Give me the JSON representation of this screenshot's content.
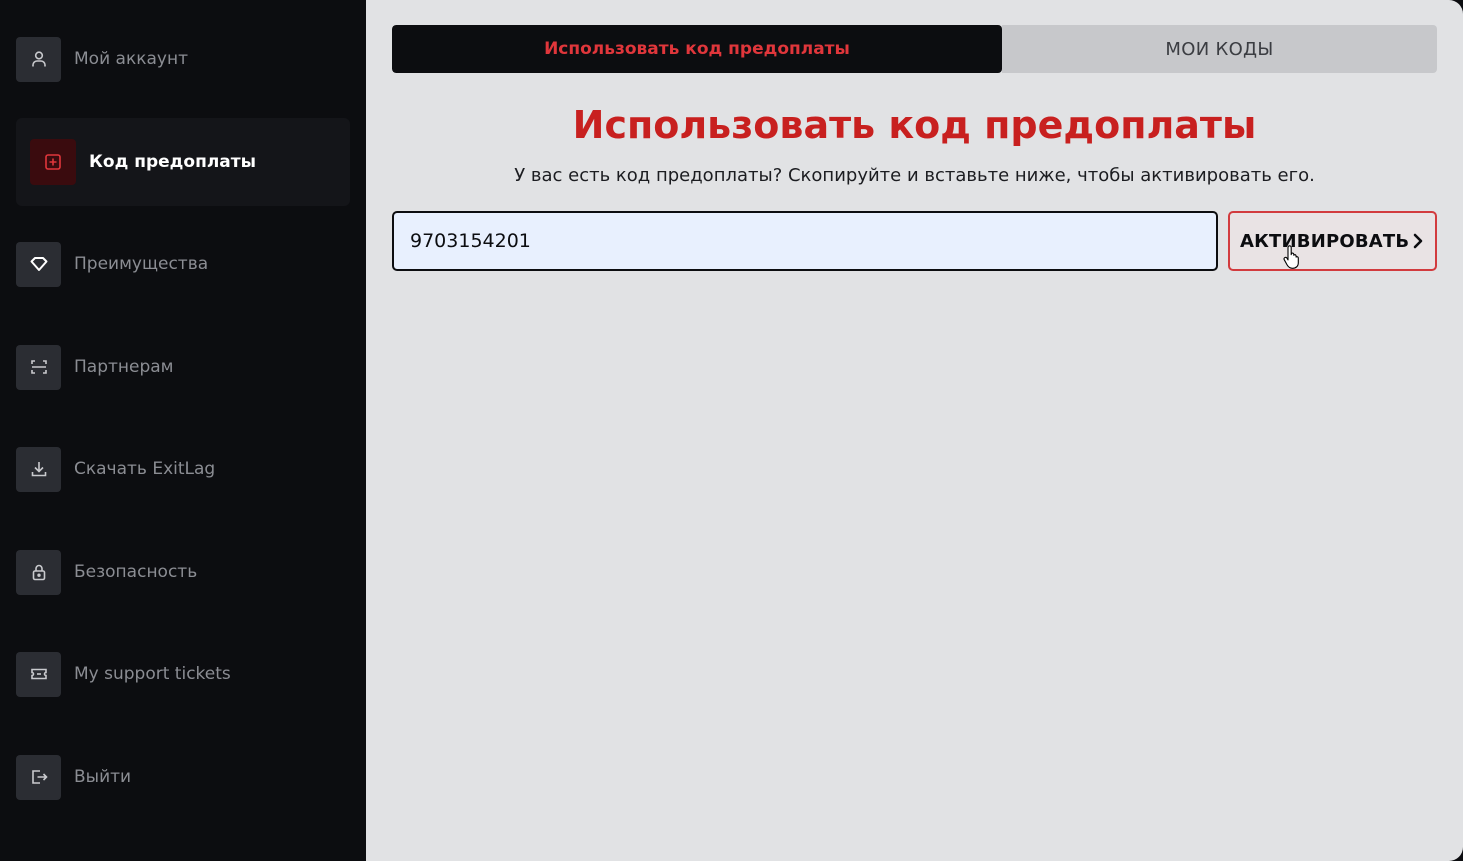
{
  "sidebar": {
    "items": [
      {
        "label": "Мой аккаунт",
        "icon": "user-icon"
      },
      {
        "label": "Код предоплаты",
        "icon": "plus-square-icon",
        "active": true
      },
      {
        "label": "Преимущества",
        "icon": "diamond-icon"
      },
      {
        "label": "Партнерам",
        "icon": "scan-icon"
      },
      {
        "label": "Скачать ExitLag",
        "icon": "download-icon"
      },
      {
        "label": "Безопасность",
        "icon": "lock-icon"
      },
      {
        "label": "My support tickets",
        "icon": "ticket-icon"
      },
      {
        "label": "Выйти",
        "icon": "logout-icon"
      }
    ]
  },
  "tabs": [
    {
      "label": "Использовать код предоплаты",
      "active": true
    },
    {
      "label": "МОИ КОДЫ",
      "active": false
    }
  ],
  "main": {
    "title": "Использовать код предоплаты",
    "subtitle": "У вас есть код предоплаты? Скопируйте и вставьте ниже, чтобы активировать его.",
    "code_value": "9703154201",
    "activate_label": "АКТИВИРОВАТЬ"
  },
  "colors": {
    "accent": "#c8201f",
    "sidebar_bg": "#0c0d10",
    "main_bg": "#e1e2e4"
  }
}
